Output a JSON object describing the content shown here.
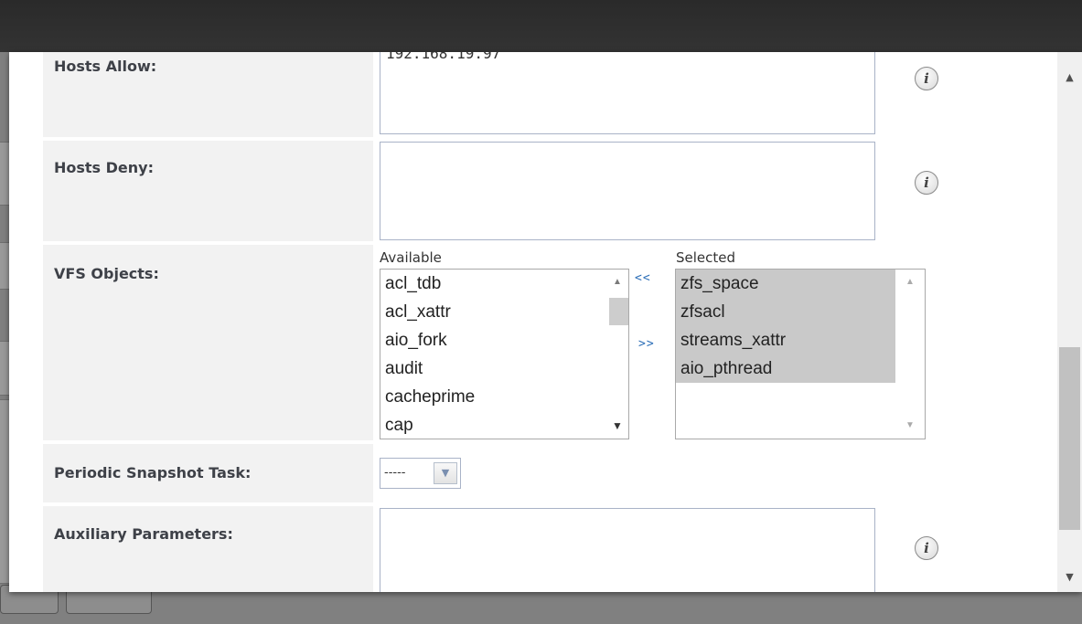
{
  "form": {
    "hosts_allow": {
      "label": "Hosts Allow:",
      "value": "192.168.19.97"
    },
    "hosts_deny": {
      "label": "Hosts Deny:",
      "value": ""
    },
    "vfs_objects": {
      "label": "VFS Objects:",
      "available_caption": "Available",
      "selected_caption": "Selected",
      "available": [
        "acl_tdb",
        "acl_xattr",
        "aio_fork",
        "audit",
        "cacheprime",
        "cap"
      ],
      "selected": [
        "zfs_space",
        "zfsacl",
        "streams_xattr",
        "aio_pthread"
      ],
      "remove_label": "<<",
      "add_label": ">>"
    },
    "periodic_snapshot": {
      "label": "Periodic Snapshot Task:",
      "value": "-----"
    },
    "auxiliary": {
      "label": "Auxiliary Parameters:",
      "value": ""
    }
  },
  "icons": {
    "info": "i",
    "scroll_up": "▲",
    "scroll_down": "▼",
    "dropdown": "▼"
  }
}
